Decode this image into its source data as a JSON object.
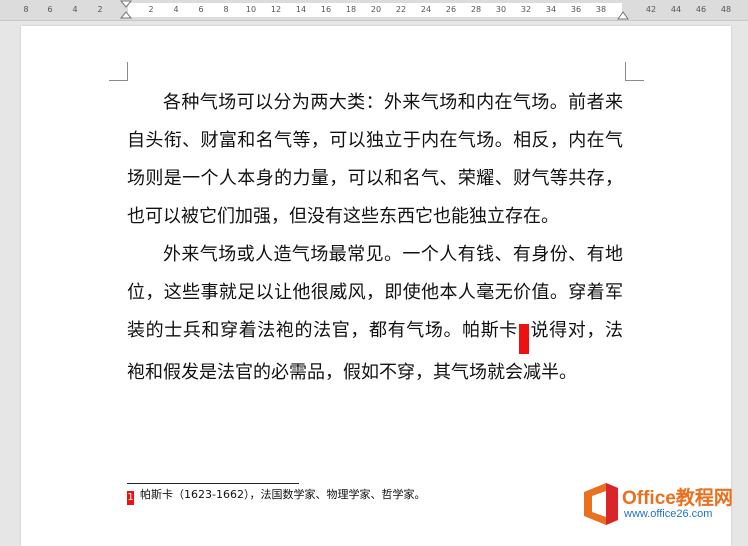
{
  "ruler": {
    "ticks": [
      "8",
      "6",
      "4",
      "2",
      "2",
      "4",
      "6",
      "8",
      "10",
      "12",
      "14",
      "16",
      "18",
      "20",
      "22",
      "24",
      "26",
      "28",
      "30",
      "32",
      "34",
      "36",
      "38",
      "42",
      "44",
      "46",
      "48"
    ]
  },
  "document": {
    "paragraphs": [
      {
        "text": "各种气场可以分为两大类：外来气场和内在气场。前者来自头衔、财富和名气等，可以独立于内在气场。相反，内在气场则是一个人本身的力量，可以和名气、荣耀、财气等共存，也可以被它们加强，但没有这些东西它也能独立存在。"
      },
      {
        "text_before": "外来气场或人造气场最常见。一个人有钱、有身份、有地位，这些事就足以让他很威风，即使他本人毫无价值。穿着军装的士兵和穿着法袍的法官，都有气场。帕斯卡",
        "ref": "1",
        "text_after": "说得对，法袍和假发是法官的必需品，假如不穿，其气场就会减半。"
      }
    ],
    "footnote": {
      "mark": "1",
      "text": "帕斯卡（1623-1662），法国数学家、物理学家、哲学家。"
    }
  },
  "watermark": {
    "title": "Office教程网",
    "url": "www.office26.com",
    "colors": {
      "orange": "#e8701e",
      "red": "#d9262b",
      "blue": "#1f74c2"
    }
  }
}
